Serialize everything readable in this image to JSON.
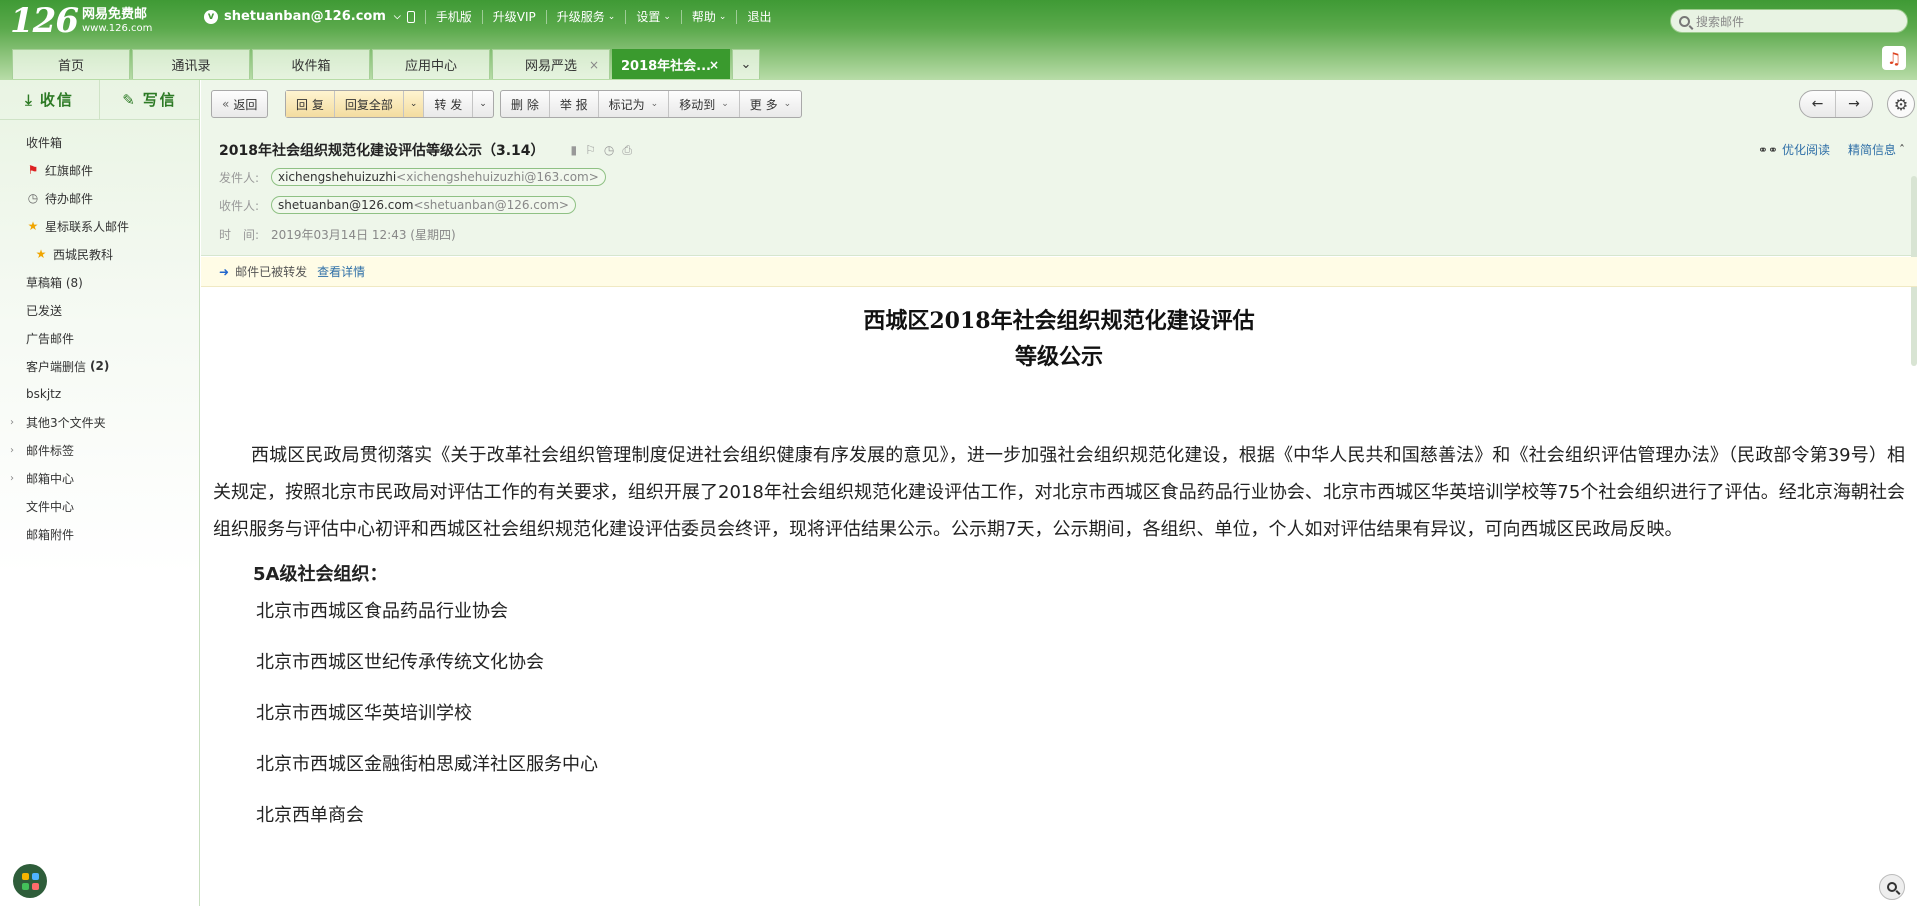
{
  "logo": {
    "number": "126",
    "name": "网易免费邮",
    "domain": "www.126.com"
  },
  "topnav": {
    "user": "shetuanban@126.com",
    "items": [
      "手机版",
      "升级VIP",
      "升级服务",
      "设置",
      "帮助",
      "退出"
    ]
  },
  "search": {
    "placeholder": "搜索邮件"
  },
  "tabs": [
    {
      "label": "首页"
    },
    {
      "label": "通讯录"
    },
    {
      "label": "收件箱"
    },
    {
      "label": "应用中心"
    },
    {
      "label": "网易严选"
    },
    {
      "label": "2018年社会..."
    }
  ],
  "sidebar": {
    "receive_label": "收信",
    "compose_label": "写信",
    "folders": [
      {
        "label": "收件箱"
      },
      {
        "label": "红旗邮件"
      },
      {
        "label": "待办邮件"
      },
      {
        "label": "星标联系人邮件"
      },
      {
        "label": "西城民教科"
      },
      {
        "label": "草稿箱 (8)"
      },
      {
        "label": "已发送"
      },
      {
        "label": "广告邮件"
      },
      {
        "label": "客户端删信",
        "count": "(2)"
      },
      {
        "label": "bskjtz"
      },
      {
        "label": "其他3个文件夹"
      },
      {
        "label": "邮件标签"
      },
      {
        "label": "邮箱中心"
      },
      {
        "label": "文件中心"
      },
      {
        "label": "邮箱附件"
      }
    ]
  },
  "toolbar": {
    "back": "返回",
    "reply": "回 复",
    "reply_all": "回复全部",
    "forward": "转 发",
    "delete": "删 除",
    "report": "举 报",
    "mark_as": "标记为",
    "move_to": "移动到",
    "more": "更 多"
  },
  "mail": {
    "subject": "2018年社会组织规范化建设评估等级公示（3.14）",
    "from_label": "发件人:",
    "from_name": "xichengshehuizuzhi",
    "from_email": "<xichengshehuizuzhi@163.com>",
    "to_label": "收件人:",
    "to_name": "shetuanban@126.com",
    "to_email": "<shetuanban@126.com>",
    "time_label": "时　间:",
    "time_value": "2019年03月14日 12:43 (星期四)",
    "optimize_reading": "优化阅读",
    "brief_info": "精简信息"
  },
  "notice": {
    "text": "邮件已被转发",
    "link": "查看详情"
  },
  "document": {
    "title_line1": "西城区2018年社会组织规范化建设评估",
    "title_line2": "等级公示",
    "body": "西城区民政局贯彻落实《关于改革社会组织管理制度促进社会组织健康有序发展的意见》，进一步加强社会组织规范化建设，根据《中华人民共和国慈善法》和《社会组织评估管理办法》（民政部令第39号）相关规定，按照北京市民政局对评估工作的有关要求，组织开展了2018年社会组织规范化建设评估工作，对北京市西城区食品药品行业协会、北京市西城区华英培训学校等75个社会组织进行了评估。经北京海朝社会组织服务与评估中心初评和西城区社会组织规范化建设评估委员会终评，现将评估结果公示。公示期7天，公示期间，各组织、单位，个人如对评估结果有异议，可向西城区民政局反映。",
    "grade_heading": "5A级社会组织：",
    "orgs": [
      "北京市西城区食品药品行业协会",
      "北京市西城区世纪传承传统文化协会",
      "北京市西城区华英培训学校",
      "北京市西城区金融街柏思威洋社区服务中心",
      "北京西单商会"
    ]
  },
  "colors": {
    "brand_green": "#3a9a2e",
    "link_blue": "#2f6fa7",
    "notice_bg": "#fffce6"
  }
}
